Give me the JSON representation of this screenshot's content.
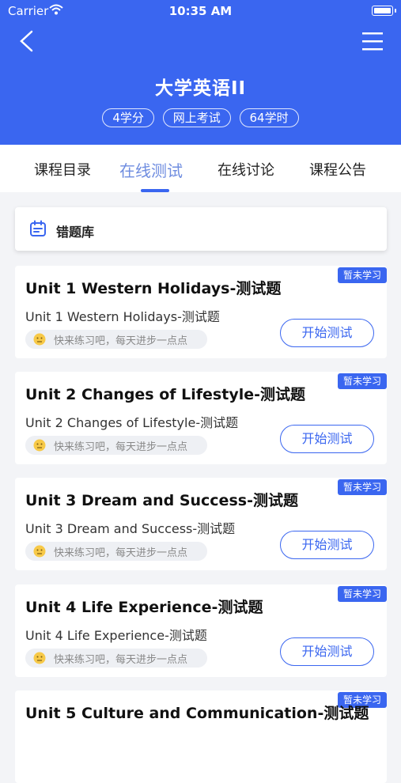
{
  "status_bar": {
    "carrier": "Carrier",
    "time": "10:35 AM"
  },
  "header": {
    "title": "大学英语II",
    "tags": [
      "4学分",
      "网上考试",
      "64学时"
    ]
  },
  "tabs": [
    {
      "label": "课程目录",
      "active": false
    },
    {
      "label": "在线测试",
      "active": true
    },
    {
      "label": "在线讨论",
      "active": false
    },
    {
      "label": "课程公告",
      "active": false
    }
  ],
  "wrong_bank": {
    "label": "错题库",
    "icon": "calendar-icon"
  },
  "tests": [
    {
      "title": "Unit 1  Western Holidays-测试题",
      "subtitle": "Unit 1  Western Holidays-测试题",
      "badge": "暂未学习",
      "tip": "快来练习吧，每天进步一点点",
      "button": "开始测试"
    },
    {
      "title": "Unit 2 Changes of Lifestyle-测试题",
      "subtitle": "Unit 2 Changes of Lifestyle-测试题",
      "badge": "暂未学习",
      "tip": "快来练习吧，每天进步一点点",
      "button": "开始测试"
    },
    {
      "title": "Unit 3 Dream and Success-测试题",
      "subtitle": "Unit 3 Dream and Success-测试题",
      "badge": "暂未学习",
      "tip": "快来练习吧，每天进步一点点",
      "button": "开始测试"
    },
    {
      "title": "Unit 4 Life Experience-测试题",
      "subtitle": "Unit 4 Life Experience-测试题",
      "badge": "暂未学习",
      "tip": "快来练习吧，每天进步一点点",
      "button": "开始测试"
    },
    {
      "title": "Unit 5  Culture and Communication-测试题",
      "badge": "暂未学习"
    }
  ],
  "colors": {
    "primary": "#3a66f0",
    "active_tab": "#6f8de0",
    "background": "#f3f4f7"
  }
}
